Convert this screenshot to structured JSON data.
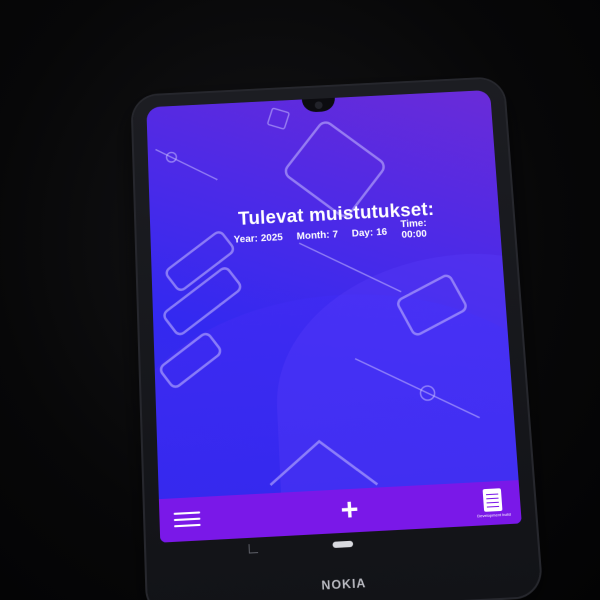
{
  "app": {
    "title": "Tulevat muistutukset:",
    "date": {
      "year_label": "Year:",
      "year_value": "2025",
      "month_label": "Month:",
      "month_value": "7",
      "day_label": "Day:",
      "day_value": "16",
      "time_label": "Time:",
      "time_value": "00:00"
    }
  },
  "bottom_nav": {
    "menu_icon": "hamburger-menu-icon",
    "add_icon": "plus-icon",
    "add_label": "+",
    "dev_icon": "document-icon",
    "dev_label": "Development build"
  },
  "device": {
    "brand": "NOKIA"
  },
  "colors": {
    "nav_bar": "#7a18e8",
    "screen_top": "#6a2bd8",
    "screen_mid": "#3329f0",
    "text": "#ffffff"
  }
}
